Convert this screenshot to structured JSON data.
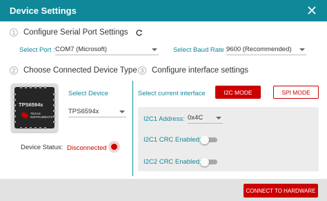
{
  "window": {
    "title": "Device Settings"
  },
  "step1": {
    "number": "1",
    "label": "Configure Serial Port Settings",
    "port_label": "Select Port :",
    "port_value": "COM7 (Microsoft)",
    "baud_label": "Select Baud Rate :",
    "baud_value": "9600 (Recommended)"
  },
  "step2": {
    "number": "2",
    "label": "Choose Connected Device Type",
    "chip_name": "TPS6594x",
    "logo_text_line1": "TEXAS",
    "logo_text_line2": "INSTRUMENTS",
    "select_device_label": "Select Device",
    "device_value": "TPS6594x",
    "status_label": "Device Status:",
    "status_value": "Disconnected"
  },
  "step3": {
    "number": "3",
    "label": "Configure interface settings",
    "interface_label": "Select current interface",
    "i2c_button": "I2C MODE",
    "spi_button": "SPI MODE",
    "i2c1_address_label": "I2C1 Address:",
    "i2c1_address_value": "0x4C",
    "i2c1_crc_label": "I2C1 CRC Enabled:",
    "i2c1_crc_enabled": false,
    "i2c2_crc_label": "I2C2 CRC Enabled:",
    "i2c2_crc_enabled": false
  },
  "footer": {
    "connect_button": "CONNECT TO HARDWARE"
  },
  "colors": {
    "titlebar": "#118899",
    "accent": "#118899",
    "primary_button": "#cc0000",
    "status_disconnected": "#cc0000"
  },
  "icons": {
    "close": "close-icon",
    "refresh": "refresh-icon",
    "dropdown": "chevron-down-icon",
    "ti_logo": "texas-instruments-logo"
  }
}
